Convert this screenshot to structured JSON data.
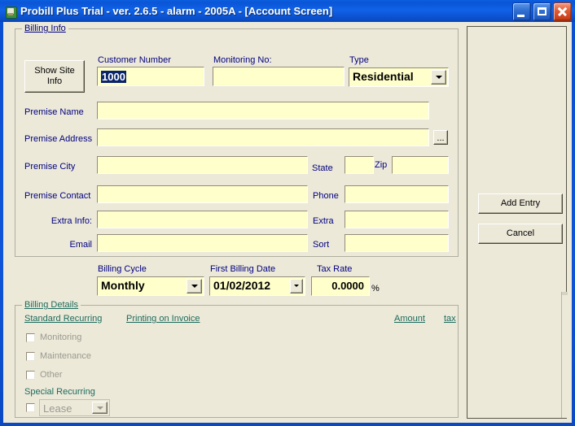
{
  "window": {
    "title": "Probill Plus Trial - ver. 2.6.5 - alarm - 2005A - [Account Screen]",
    "icon": "app-icon",
    "minimize_label": "",
    "maximize_label": "",
    "close_label": ""
  },
  "billing_info": {
    "group_title": "Billing Info",
    "show_site_info_line1": "Show Site",
    "show_site_info_line2": "Info",
    "customer_number_label": "Customer Number",
    "customer_number_value": "1000",
    "monitoring_no_label": "Monitoring No:",
    "monitoring_no_value": "",
    "type_label": "Type",
    "type_value": "Residential",
    "premise_name_label": "Premise Name",
    "premise_name_value": "",
    "premise_address_label": "Premise Address",
    "premise_address_value": "",
    "address_browse_label": "...",
    "premise_city_label": "Premise City",
    "premise_city_value": "",
    "state_label": "State",
    "state_value": "",
    "zip_label": "Zip",
    "zip_value": "",
    "premise_contact_label": "Premise Contact",
    "premise_contact_value": "",
    "phone_label": "Phone",
    "phone_value": "",
    "extra_info_label": "Extra Info:",
    "extra_info_value": "",
    "extra_label": "Extra",
    "extra_value": "",
    "email_label": "Email",
    "email_value": "",
    "sort_label": "Sort",
    "sort_value": ""
  },
  "billing_cycle_row": {
    "billing_cycle_label": "Billing Cycle",
    "billing_cycle_value": "Monthly",
    "first_billing_date_label": "First Billing Date",
    "first_billing_date_value": "01/02/2012",
    "tax_rate_label": "Tax Rate",
    "tax_rate_value": "0.0000",
    "tax_rate_suffix": "%"
  },
  "billing_details": {
    "group_title": "Billing Details",
    "standard_recurring_label": "Standard Recurring",
    "printing_on_invoice_label": "Printing on Invoice",
    "amount_label": "Amount",
    "tax_label": "tax",
    "rows": [
      {
        "label": "Monitoring",
        "checked": false
      },
      {
        "label": "Maintenance",
        "checked": false
      },
      {
        "label": "Other",
        "checked": false
      }
    ],
    "special_recurring_label": "Special Recurring",
    "special_recurring_value": "Lease",
    "special_recurring_checked": false
  },
  "actions": {
    "add_entry_label": "Add Entry",
    "cancel_label": "Cancel"
  },
  "colors": {
    "titlebar_blue": "#0a55d6",
    "face": "#ece9d8",
    "field_yellow": "#ffffcc",
    "label_navy": "#000080",
    "label_teal": "#1d6b5e",
    "selection": "#0a246a",
    "disabled_gray": "#9a9a90"
  }
}
